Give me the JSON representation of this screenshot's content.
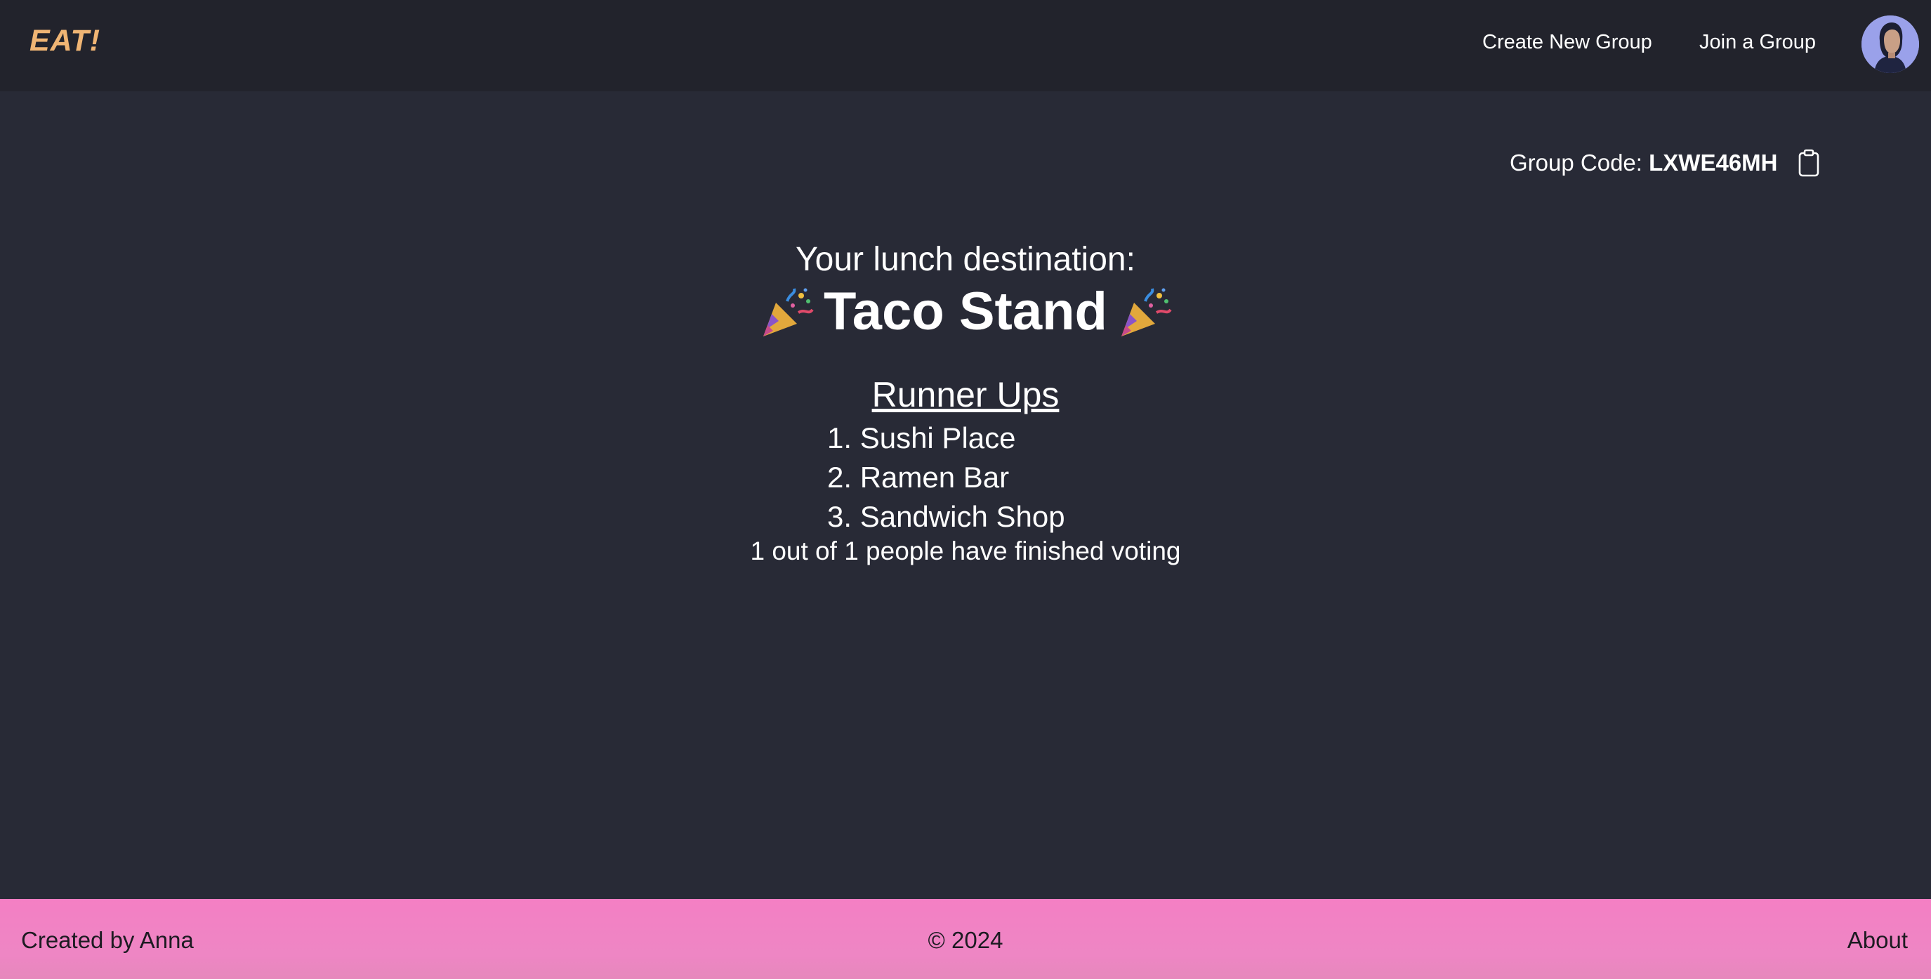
{
  "navbar": {
    "logo": "EAT!",
    "links": {
      "create_group": "Create New Group",
      "join_group": "Join a Group"
    }
  },
  "group": {
    "label": "Group Code:",
    "code": "LXWE46MH"
  },
  "result": {
    "heading": "Your lunch destination:",
    "winner": "Taco Stand",
    "runner_ups_title": "Runner Ups",
    "runner_ups": [
      "1. Sushi Place",
      "2. Ramen Bar",
      "3. Sandwich Shop"
    ],
    "voting_status": "1 out of 1 people have finished voting"
  },
  "footer": {
    "credit": "Created by Anna",
    "copyright": "© 2024",
    "about": "About"
  },
  "icons": {
    "copy": "clipboard-icon",
    "celebrate": "party-popper-icon",
    "avatar": "user-avatar"
  },
  "colors": {
    "background": "#282a36",
    "navbar": "#22232c",
    "logo": "#f0b574",
    "footer": "#f47fc4"
  }
}
